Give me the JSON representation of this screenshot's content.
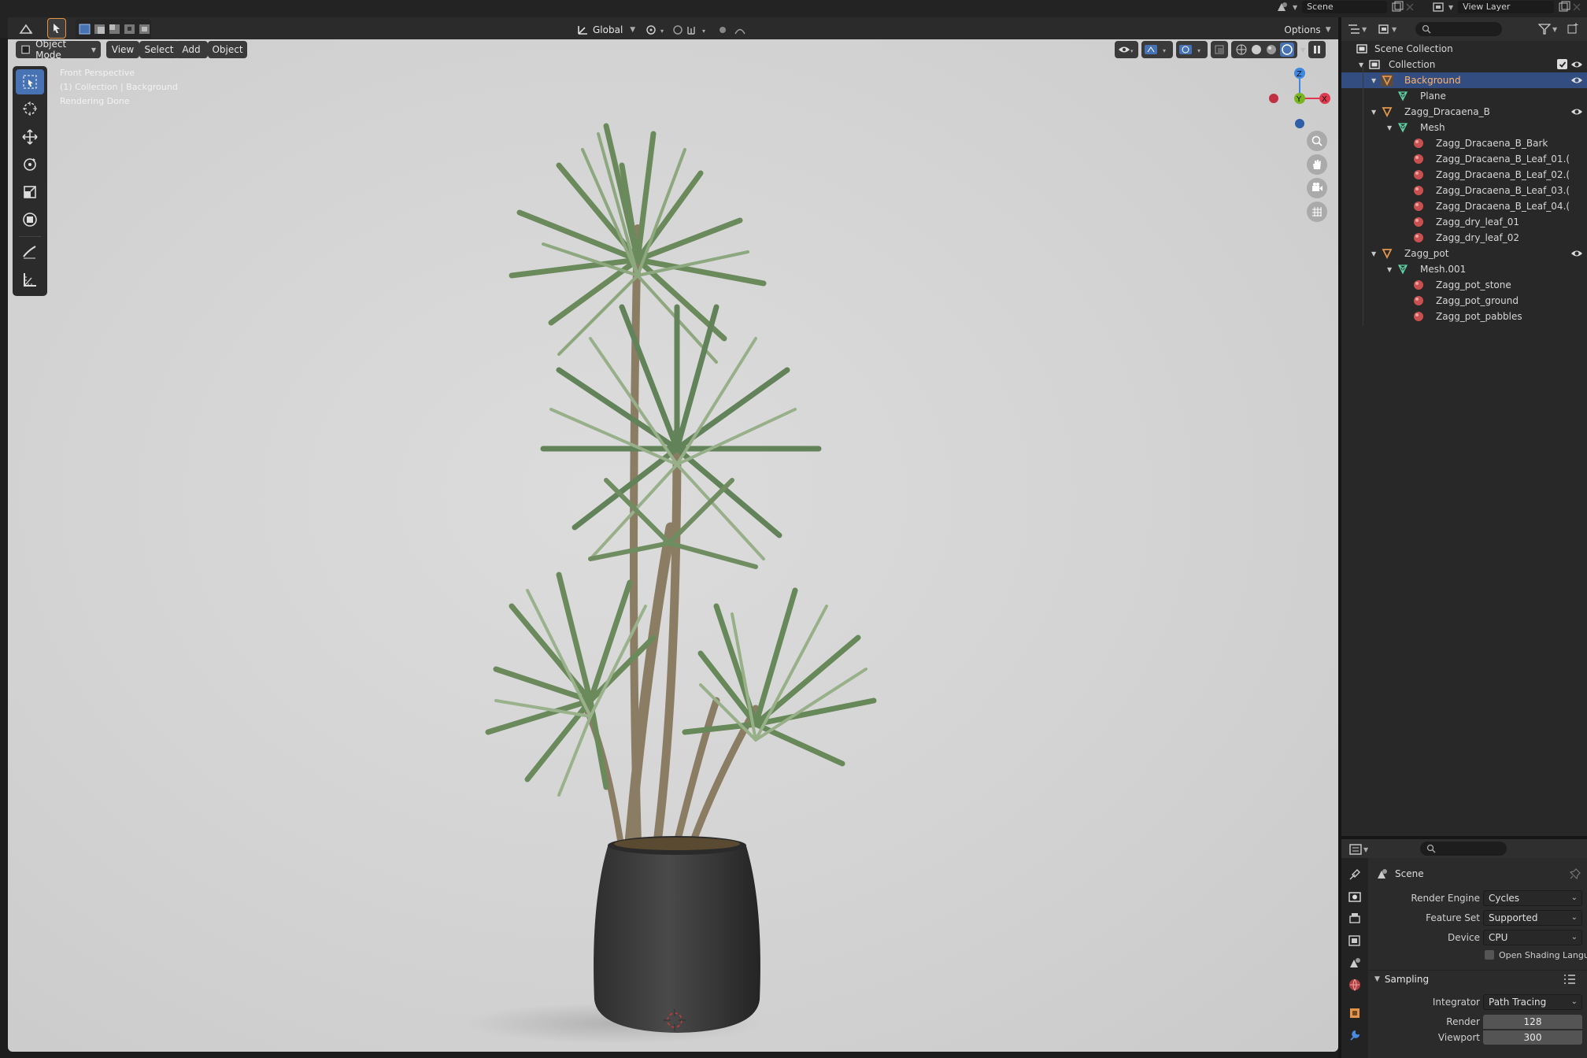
{
  "topbar": {
    "scene_label": "Scene",
    "view_layer_label": "View Layer"
  },
  "viewport_header": {
    "transform_orientation": "Global",
    "options_label": "Options",
    "mode_label": "Object Mode",
    "menus": [
      "View",
      "Select",
      "Add",
      "Object"
    ]
  },
  "viewport": {
    "overlay_lines": [
      "Front Perspective",
      "(1) Collection | Background",
      "Rendering Done"
    ],
    "gizmo": {
      "z": "Z",
      "y": "Y",
      "x": "X"
    }
  },
  "outliner": {
    "search_placeholder": "",
    "rows": [
      {
        "label": "Scene Collection",
        "indent": 0,
        "icon": "scene-collection-icon",
        "type": "scene"
      },
      {
        "label": "Collection",
        "indent": 1,
        "icon": "collection-icon",
        "type": "collection",
        "expanded": true
      },
      {
        "label": "Background",
        "indent": 2,
        "icon": "object-icon",
        "type": "object",
        "expanded": true,
        "selected": true
      },
      {
        "label": "Plane",
        "indent": 3,
        "icon": "mesh-icon",
        "type": "mesh"
      },
      {
        "label": "Zagg_Dracaena_B",
        "indent": 2,
        "icon": "object-icon",
        "type": "object",
        "expanded": true
      },
      {
        "label": "Mesh",
        "indent": 3,
        "icon": "mesh-icon",
        "type": "mesh",
        "expanded": true
      },
      {
        "label": "Zagg_Dracaena_B_Bark",
        "indent": 4,
        "icon": "material-icon",
        "type": "material"
      },
      {
        "label": "Zagg_Dracaena_B_Leaf_01.(",
        "indent": 4,
        "icon": "material-icon",
        "type": "material"
      },
      {
        "label": "Zagg_Dracaena_B_Leaf_02.(",
        "indent": 4,
        "icon": "material-icon",
        "type": "material"
      },
      {
        "label": "Zagg_Dracaena_B_Leaf_03.(",
        "indent": 4,
        "icon": "material-icon",
        "type": "material"
      },
      {
        "label": "Zagg_Dracaena_B_Leaf_04.(",
        "indent": 4,
        "icon": "material-icon",
        "type": "material"
      },
      {
        "label": "Zagg_dry_leaf_01",
        "indent": 4,
        "icon": "material-icon",
        "type": "material"
      },
      {
        "label": "Zagg_dry_leaf_02",
        "indent": 4,
        "icon": "material-icon",
        "type": "material"
      },
      {
        "label": "Zagg_pot",
        "indent": 2,
        "icon": "object-icon",
        "type": "object",
        "expanded": true
      },
      {
        "label": "Mesh.001",
        "indent": 3,
        "icon": "mesh-icon",
        "type": "mesh",
        "expanded": true
      },
      {
        "label": "Zagg_pot_stone",
        "indent": 4,
        "icon": "material-icon",
        "type": "material"
      },
      {
        "label": "Zagg_pot_ground",
        "indent": 4,
        "icon": "material-icon",
        "type": "material"
      },
      {
        "label": "Zagg_pot_pabbles",
        "indent": 4,
        "icon": "material-icon",
        "type": "material"
      }
    ]
  },
  "properties": {
    "context_title": "Scene",
    "render_engine": {
      "label": "Render Engine",
      "value": "Cycles"
    },
    "feature_set": {
      "label": "Feature Set",
      "value": "Supported"
    },
    "device": {
      "label": "Device",
      "value": "CPU"
    },
    "osl": {
      "label": "Open Shading Language",
      "checked": false
    },
    "sampling": {
      "title": "Sampling",
      "integrator": {
        "label": "Integrator",
        "value": "Path Tracing"
      },
      "render": {
        "label": "Render",
        "value": "128"
      },
      "viewport": {
        "label": "Viewport",
        "value": "300"
      }
    }
  },
  "colors": {
    "accent": "#4772b3",
    "selected_row": "#334d80",
    "viewport_bg": "#d4d4d4",
    "object_orange": "#e3954a",
    "mesh_green": "#5fd3a6",
    "material_red": "#e36a6a",
    "axis_x": "#e0384c",
    "axis_y": "#79b51c",
    "axis_z": "#3f88e0"
  }
}
